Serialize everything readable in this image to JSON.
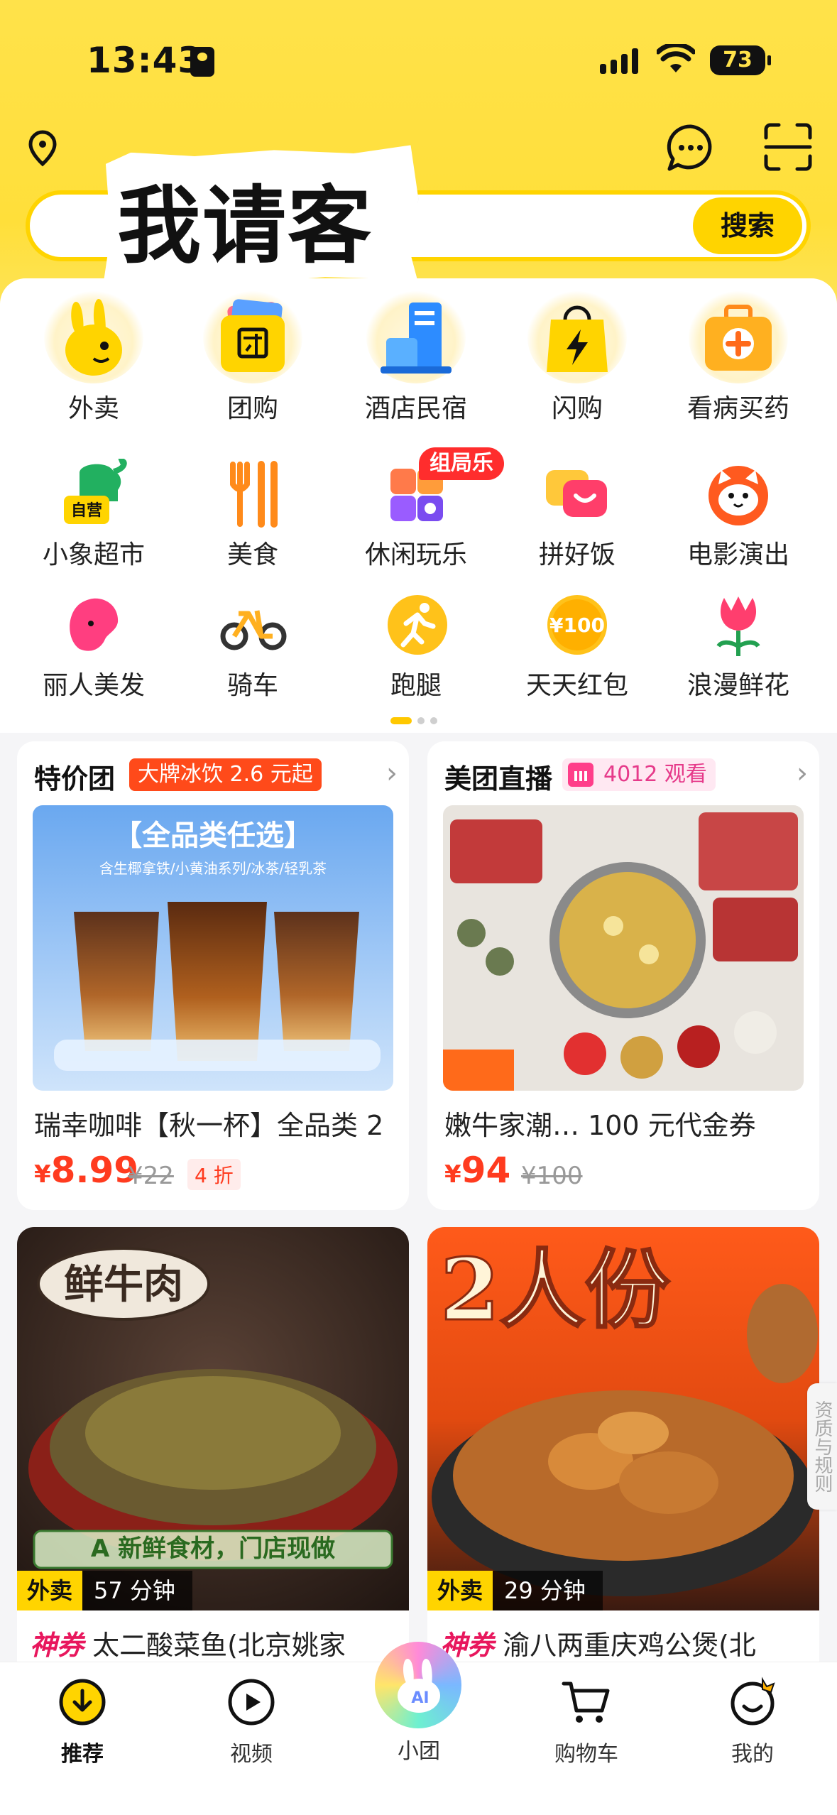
{
  "status": {
    "time": "13:43",
    "battery": "73"
  },
  "search": {
    "sticker_text": "我请客",
    "button_label": "搜索"
  },
  "categories": [
    {
      "label": "外卖",
      "icon": "kangaroo-icon"
    },
    {
      "label": "团购",
      "icon": "ticket-icon"
    },
    {
      "label": "酒店民宿",
      "icon": "hotel-icon"
    },
    {
      "label": "闪购",
      "icon": "lightning-bag-icon"
    },
    {
      "label": "看病买药",
      "icon": "medkit-icon"
    },
    {
      "label": "小象超市",
      "icon": "elephant-icon",
      "sub": "自营"
    },
    {
      "label": "美食",
      "icon": "fork-knife-icon"
    },
    {
      "label": "休闲玩乐",
      "icon": "leisure-icon",
      "badge": "组局乐"
    },
    {
      "label": "拼好饭",
      "icon": "chat-bubble-icon"
    },
    {
      "label": "电影演出",
      "icon": "cat-face-icon"
    },
    {
      "label": "丽人美发",
      "icon": "hair-icon"
    },
    {
      "label": "骑车",
      "icon": "bike-icon"
    },
    {
      "label": "跑腿",
      "icon": "runner-icon"
    },
    {
      "label": "天天红包",
      "icon": "coin-icon",
      "coin": "¥100"
    },
    {
      "label": "浪漫鲜花",
      "icon": "tulip-icon"
    }
  ],
  "deal_card": {
    "title": "特价团",
    "pill": "大牌冰饮 2.6 元起",
    "banner_title": "【全品类任选】",
    "banner_sub": "含生椰拿铁/小黄油系列/冰茶/轻乳茶",
    "name": "瑞幸咖啡【秋一杯】全品类 2",
    "price_symbol": "¥",
    "price": "8.99",
    "old_price": "¥22",
    "discount": "4 折"
  },
  "live_card": {
    "title": "美团直播",
    "viewers": "4012 观看",
    "name": "嫩牛家潮…  100 元代金券",
    "price_symbol": "¥",
    "price": "94",
    "old_price": "¥100"
  },
  "food_cards": [
    {
      "overlay_title": "鲜牛肉",
      "overlay_sub": "A 新鲜食材，门店现做",
      "tag": "外卖",
      "time": "57 分钟",
      "coupon": "神券",
      "name": "太二酸菜鱼(北京姚家"
    },
    {
      "overlay_title": "2人份",
      "tag": "外卖",
      "time": "29 分钟",
      "coupon": "神券",
      "name": "渝八两重庆鸡公煲(北"
    }
  ],
  "side_tab": "资质与规则",
  "nav": [
    {
      "label": "推荐",
      "icon": "download-circle-icon"
    },
    {
      "label": "视频",
      "icon": "play-circle-icon"
    },
    {
      "label": "小团",
      "icon": "ai-bunny-icon"
    },
    {
      "label": "购物车",
      "icon": "cart-icon"
    },
    {
      "label": "我的",
      "icon": "smile-icon"
    }
  ],
  "colors": {
    "brand": "#ffd400",
    "price": "#ff3b1f",
    "coupon": "#e8175d"
  }
}
